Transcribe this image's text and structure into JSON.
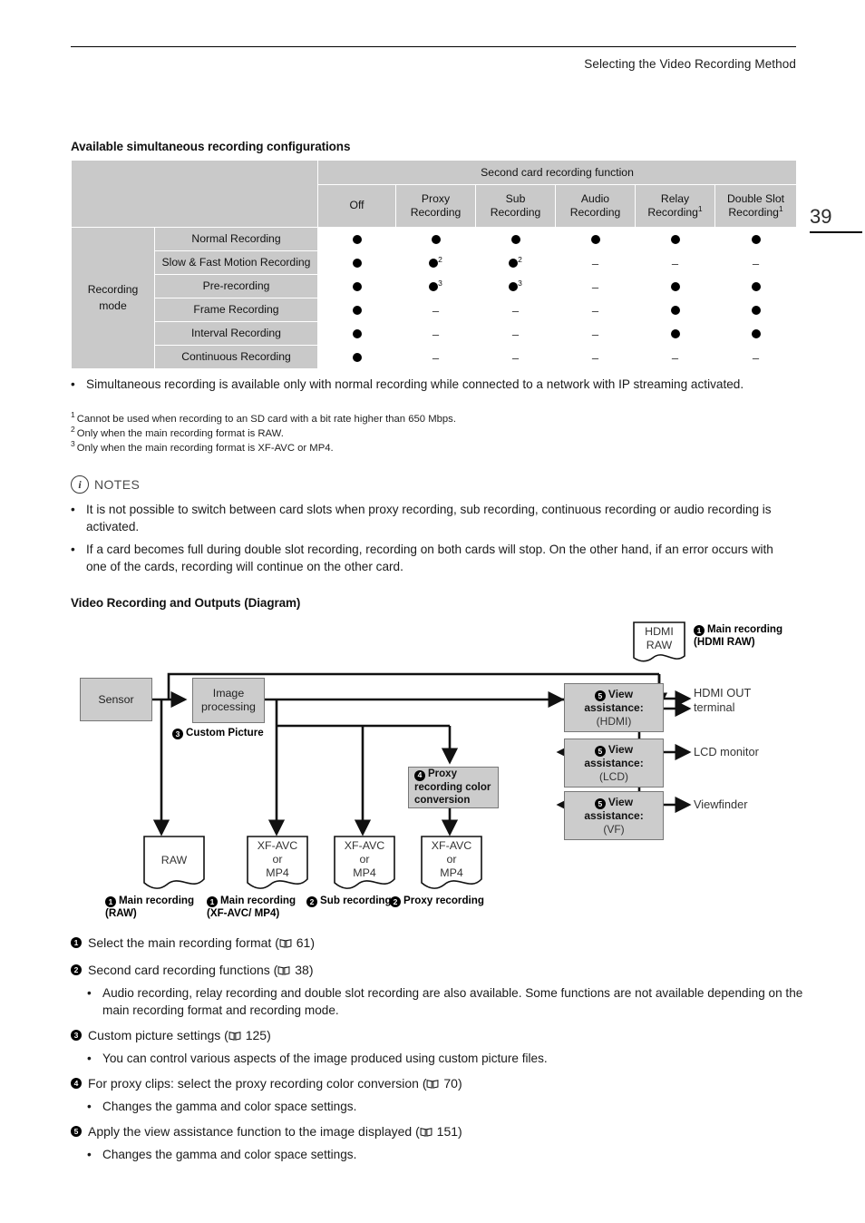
{
  "header": {
    "running_head": "Selecting the Video Recording Method",
    "page_number": "39"
  },
  "sections": {
    "available_heading": "Available simultaneous recording configurations",
    "diagram_heading": "Video Recording and Outputs (Diagram)"
  },
  "table": {
    "group_header": "Second card recording function",
    "row_group_label_line1": "Recording",
    "row_group_label_line2": "mode",
    "columns": [
      {
        "line1": "Off",
        "line2": "",
        "sup": ""
      },
      {
        "line1": "Proxy",
        "line2": "Recording",
        "sup": ""
      },
      {
        "line1": "Sub",
        "line2": "Recording",
        "sup": ""
      },
      {
        "line1": "Audio",
        "line2": "Recording",
        "sup": ""
      },
      {
        "line1": "Relay",
        "line2": "Recording",
        "sup": "1"
      },
      {
        "line1": "Double Slot",
        "line2": "Recording",
        "sup": "1"
      }
    ],
    "rows": [
      {
        "label": "Normal Recording",
        "cells": [
          {
            "mark": "dot",
            "sup": ""
          },
          {
            "mark": "dot",
            "sup": ""
          },
          {
            "mark": "dot",
            "sup": ""
          },
          {
            "mark": "dot",
            "sup": ""
          },
          {
            "mark": "dot",
            "sup": ""
          },
          {
            "mark": "dot",
            "sup": ""
          }
        ]
      },
      {
        "label": "Slow & Fast Motion Recording",
        "cells": [
          {
            "mark": "dot",
            "sup": ""
          },
          {
            "mark": "dot",
            "sup": "2"
          },
          {
            "mark": "dot",
            "sup": "2"
          },
          {
            "mark": "dash",
            "sup": ""
          },
          {
            "mark": "dash",
            "sup": ""
          },
          {
            "mark": "dash",
            "sup": ""
          }
        ]
      },
      {
        "label": "Pre-recording",
        "cells": [
          {
            "mark": "dot",
            "sup": ""
          },
          {
            "mark": "dot",
            "sup": "3"
          },
          {
            "mark": "dot",
            "sup": "3"
          },
          {
            "mark": "dash",
            "sup": ""
          },
          {
            "mark": "dot",
            "sup": ""
          },
          {
            "mark": "dot",
            "sup": ""
          }
        ]
      },
      {
        "label": "Frame Recording",
        "cells": [
          {
            "mark": "dot",
            "sup": ""
          },
          {
            "mark": "dash",
            "sup": ""
          },
          {
            "mark": "dash",
            "sup": ""
          },
          {
            "mark": "dash",
            "sup": ""
          },
          {
            "mark": "dot",
            "sup": ""
          },
          {
            "mark": "dot",
            "sup": ""
          }
        ]
      },
      {
        "label": "Interval Recording",
        "cells": [
          {
            "mark": "dot",
            "sup": ""
          },
          {
            "mark": "dash",
            "sup": ""
          },
          {
            "mark": "dash",
            "sup": ""
          },
          {
            "mark": "dash",
            "sup": ""
          },
          {
            "mark": "dot",
            "sup": ""
          },
          {
            "mark": "dot",
            "sup": ""
          }
        ]
      },
      {
        "label": "Continuous Recording",
        "cells": [
          {
            "mark": "dot",
            "sup": ""
          },
          {
            "mark": "dash",
            "sup": ""
          },
          {
            "mark": "dash",
            "sup": ""
          },
          {
            "mark": "dash",
            "sup": ""
          },
          {
            "mark": "dash",
            "sup": ""
          },
          {
            "mark": "dash",
            "sup": ""
          }
        ]
      }
    ]
  },
  "table_notes": {
    "bullet": "Simultaneous recording is available only with normal recording while connected to a network with IP streaming activated.",
    "footnotes": [
      {
        "num": "1",
        "text": "Cannot be used when recording to an SD card with a bit rate higher than 650 Mbps."
      },
      {
        "num": "2",
        "text": "Only when the main recording format is RAW."
      },
      {
        "num": "3",
        "text": "Only when the main recording format is XF-AVC or MP4."
      }
    ]
  },
  "notes": {
    "label": "NOTES",
    "icon": "info-circle-icon",
    "items": [
      "It is not possible to switch between card slots when proxy recording, sub recording, continuous recording or audio recording is activated.",
      "If a card becomes full during double slot recording, recording on both cards will stop. On the other hand, if an error occurs with one of the cards, recording will continue on the other card."
    ]
  },
  "diagram": {
    "sensor": "Sensor",
    "image_processing_line1": "Image",
    "image_processing_line2": "processing",
    "custom_picture_num": "3",
    "custom_picture_label": "Custom Picture",
    "proxy_conv_num": "4",
    "proxy_conv_line1": "Proxy",
    "proxy_conv_line2": "recording color",
    "proxy_conv_line3": "conversion",
    "hdmi_raw_line1": "HDMI",
    "hdmi_raw_line2": "RAW",
    "hdmi_raw_caption_num": "1",
    "hdmi_raw_caption_line1": "Main recording",
    "hdmi_raw_caption_line2": "(HDMI RAW)",
    "view_assist": [
      {
        "num": "5",
        "title": "View",
        "title2": "assistance:",
        "sub": "(HDMI)",
        "output_line1": "HDMI OUT",
        "output_line2": "terminal"
      },
      {
        "num": "5",
        "title": "View",
        "title2": "assistance:",
        "sub": "(LCD)",
        "output_line1": "LCD monitor",
        "output_line2": ""
      },
      {
        "num": "5",
        "title": "View",
        "title2": "assistance:",
        "sub": "(VF)",
        "output_line1": "Viewfinder",
        "output_line2": ""
      }
    ],
    "outputs": [
      {
        "doc_line1": "RAW",
        "doc_line2": "",
        "doc_line3": "",
        "cap_num": "1",
        "cap_line1": "Main recording",
        "cap_line2": "(RAW)"
      },
      {
        "doc_line1": "XF-AVC",
        "doc_line2": "or",
        "doc_line3": "MP4",
        "cap_num": "1",
        "cap_line1": "Main recording",
        "cap_line2": "(XF-AVC/ MP4)"
      },
      {
        "doc_line1": "XF-AVC",
        "doc_line2": "or",
        "doc_line3": "MP4",
        "cap_num": "2",
        "cap_line1": "Sub recording",
        "cap_line2": ""
      },
      {
        "doc_line1": "XF-AVC",
        "doc_line2": "or",
        "doc_line3": "MP4",
        "cap_num": "2",
        "cap_line1": "Proxy recording",
        "cap_line2": ""
      }
    ]
  },
  "legend": [
    {
      "num": "1",
      "text_before": "Select the main recording format (",
      "page_ref": "61",
      "text_after": ")",
      "subs": []
    },
    {
      "num": "2",
      "text_before": "Second card recording functions (",
      "page_ref": "38",
      "text_after": ")",
      "subs": [
        "Audio recording, relay recording and double slot recording are also available. Some functions are not available depending on the main recording format and recording mode."
      ]
    },
    {
      "num": "3",
      "text_before": "Custom picture settings (",
      "page_ref": "125",
      "text_after": ")",
      "subs": [
        "You can control various aspects of the image produced using custom picture files."
      ]
    },
    {
      "num": "4",
      "text_before": "For proxy clips: select the proxy recording color conversion (",
      "page_ref": "70",
      "text_after": ")",
      "subs": [
        "Changes the gamma and color space settings."
      ]
    },
    {
      "num": "5",
      "text_before": "Apply the view assistance function to the image displayed (",
      "page_ref": "151",
      "text_after": ")",
      "subs": [
        "Changes the gamma and color space settings."
      ]
    }
  ],
  "colors": {
    "box_fill": "#cccccc",
    "table_header_fill": "#c9c9c9",
    "line": "#000000"
  }
}
